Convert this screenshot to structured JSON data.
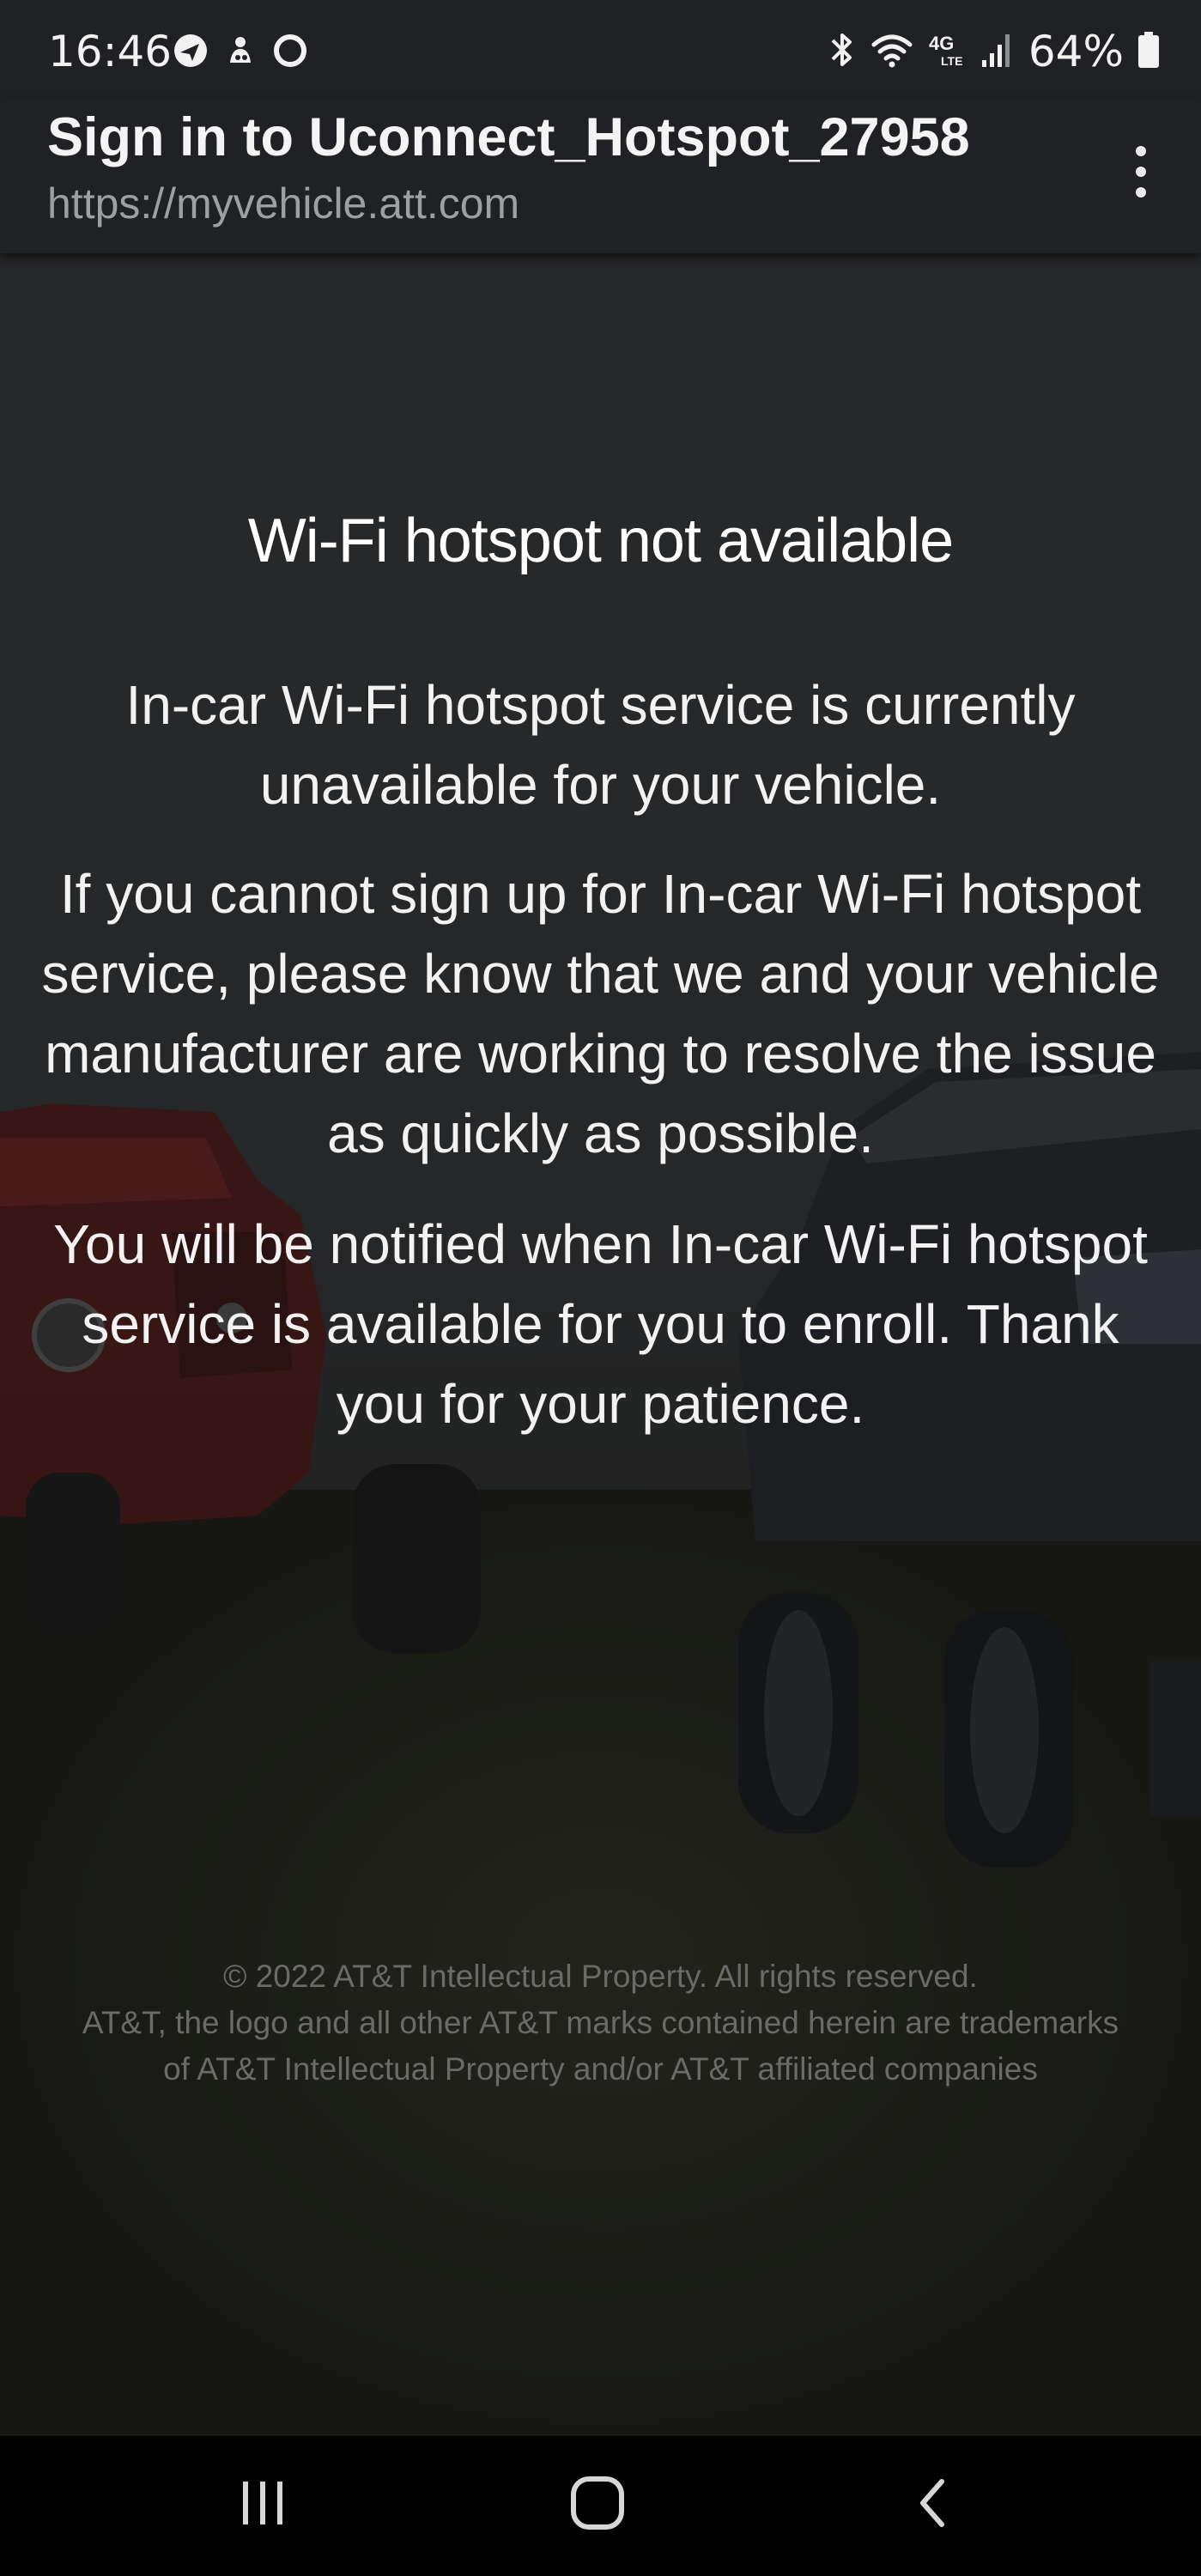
{
  "status_bar": {
    "time": "16:46",
    "battery": "64%",
    "network": "4G LTE",
    "left_icons": [
      "navigation-app-icon",
      "notification-app-icon",
      "sync-icon"
    ],
    "right_icons": [
      "bluetooth-icon",
      "wifi-icon",
      "lte-icon",
      "signal-icon",
      "battery-icon"
    ]
  },
  "header": {
    "title": "Sign in to Uconnect_Hotspot_27958",
    "url": "https://myvehicle.att.com"
  },
  "main": {
    "heading": "Wi-Fi hotspot not available",
    "paragraphs": [
      "In-car Wi-Fi hotspot service is currently unavailable for your vehicle.",
      "If you cannot sign up for In-car Wi-Fi hotspot service, please know that we and your vehicle manufacturer are working to resolve the issue as quickly as possible.",
      "You will be notified when In-car Wi-Fi hotspot service is available for you to enroll. Thank you for your patience."
    ]
  },
  "footer": {
    "copyright": "© 2022 AT&T Intellectual Property. All rights reserved.",
    "trademark": "AT&T, the logo and all other AT&T marks contained herein are trademarks of AT&T Intellectual Property and/or AT&T affiliated companies"
  },
  "nav_bar": {
    "buttons": [
      "recent-apps-icon",
      "home-icon",
      "back-icon"
    ]
  },
  "colors": {
    "bar_background": "#202124",
    "content_background": "#242527",
    "text": "#ffffff",
    "muted_text": "#9d9fa3",
    "footer_text": "#6a6a68",
    "jeep_red": "#6e1f1e",
    "nav_background": "#000000"
  }
}
